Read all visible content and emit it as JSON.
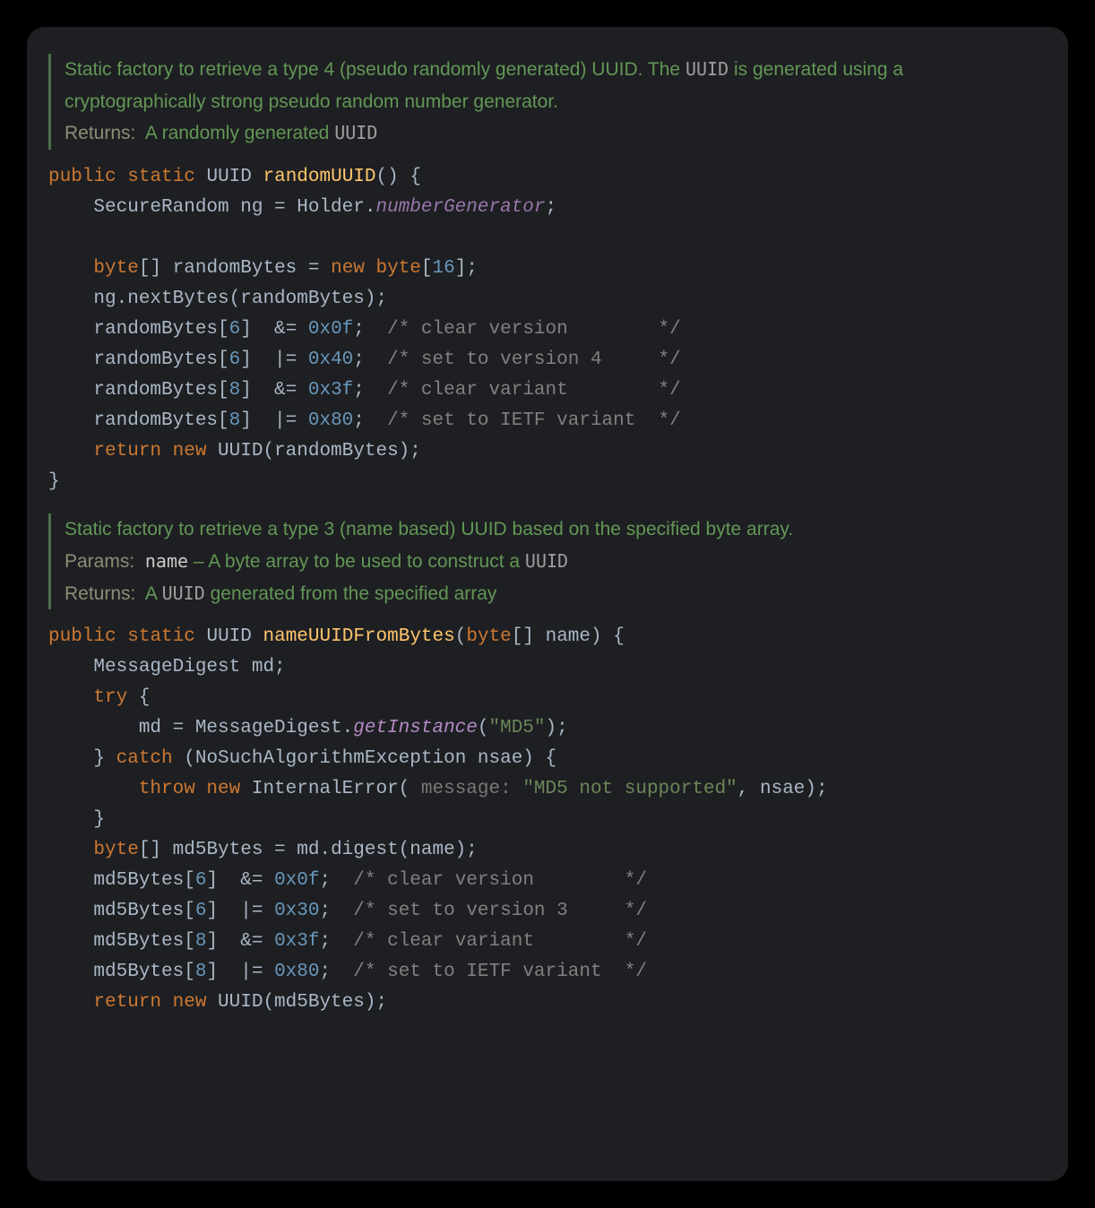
{
  "doc1": {
    "desc_a": "Static factory to retrieve a type 4 (pseudo randomly generated) UUID. The ",
    "desc_uuid": "UUID",
    "desc_b": " is generated using a cryptographically strong pseudo random number generator.",
    "returns_label": "Returns:",
    "returns_a": "A randomly generated ",
    "returns_uuid": "UUID"
  },
  "m1": {
    "public": "public",
    "static": "static",
    "uuid": "UUID",
    "name": "randomUUID",
    "sig_tail": "() {",
    "l1": {
      "a": "    SecureRandom ng = Holder.",
      "fld": "numberGenerator",
      "b": ";"
    },
    "l2_a": "    ",
    "l2_kw1": "byte",
    "l2_b": "[] randomBytes = ",
    "l2_kw2": "new byte",
    "l2_c": "[",
    "l2_num": "16",
    "l2_d": "];",
    "l3": "    ng.nextBytes(randomBytes);",
    "l4": {
      "a": "    randomBytes[",
      "i": "6",
      "b": "]  &= ",
      "v": "0x0f",
      "c": ";  ",
      "cmt": "/* clear version        */"
    },
    "l5": {
      "a": "    randomBytes[",
      "i": "6",
      "b": "]  |= ",
      "v": "0x40",
      "c": ";  ",
      "cmt": "/* set to version 4     */"
    },
    "l6": {
      "a": "    randomBytes[",
      "i": "8",
      "b": "]  &= ",
      "v": "0x3f",
      "c": ";  ",
      "cmt": "/* clear variant        */"
    },
    "l7": {
      "a": "    randomBytes[",
      "i": "8",
      "b": "]  |= ",
      "v": "0x80",
      "c": ";  ",
      "cmt": "/* set to IETF variant  */"
    },
    "l8": {
      "kw": "    return new",
      "b": " UUID(randomBytes);"
    },
    "close": "}"
  },
  "doc2": {
    "desc": "Static factory to retrieve a type 3 (name based) UUID based on the specified byte array.",
    "params_label": "Params:",
    "pname": "name",
    "pdesc_a": " – A byte array to be used to construct a ",
    "pdesc_uuid": "UUID",
    "returns_label": "Returns:",
    "returns_a": "A ",
    "returns_uuid": "UUID",
    "returns_b": " generated from the specified array"
  },
  "m2": {
    "public": "public",
    "static": "static",
    "uuid": "UUID",
    "name": "nameUUIDFromBytes",
    "sig_b": "(",
    "sig_kw": "byte",
    "sig_c": "[] name) {",
    "l1": "    MessageDigest md;",
    "l2": {
      "kw": "    try",
      "b": " {"
    },
    "l3": {
      "a": "        md = MessageDigest.",
      "sm": "getInstance",
      "b": "(",
      "str": "\"MD5\"",
      "c": ");"
    },
    "l4": {
      "a": "    } ",
      "kw": "catch",
      "b": " (NoSuchAlgorithmException nsae) {"
    },
    "l5": {
      "kw": "        throw new",
      "a": " InternalError( ",
      "hint": "message:",
      "b": " ",
      "str": "\"MD5 not supported\"",
      "c": ", nsae);"
    },
    "l6": "    }",
    "l7": {
      "kw": "    byte",
      "a": "[] md5Bytes = md.digest(name);"
    },
    "b1": {
      "a": "    md5Bytes[",
      "i": "6",
      "b": "]  &= ",
      "v": "0x0f",
      "c": ";  ",
      "cmt": "/* clear version        */"
    },
    "b2": {
      "a": "    md5Bytes[",
      "i": "6",
      "b": "]  |= ",
      "v": "0x30",
      "c": ";  ",
      "cmt": "/* set to version 3     */"
    },
    "b3": {
      "a": "    md5Bytes[",
      "i": "8",
      "b": "]  &= ",
      "v": "0x3f",
      "c": ";  ",
      "cmt": "/* clear variant        */"
    },
    "b4": {
      "a": "    md5Bytes[",
      "i": "8",
      "b": "]  |= ",
      "v": "0x80",
      "c": ";  ",
      "cmt": "/* set to IETF variant  */"
    },
    "l8": {
      "kw": "    return new",
      "b": " UUID(md5Bytes);"
    }
  }
}
